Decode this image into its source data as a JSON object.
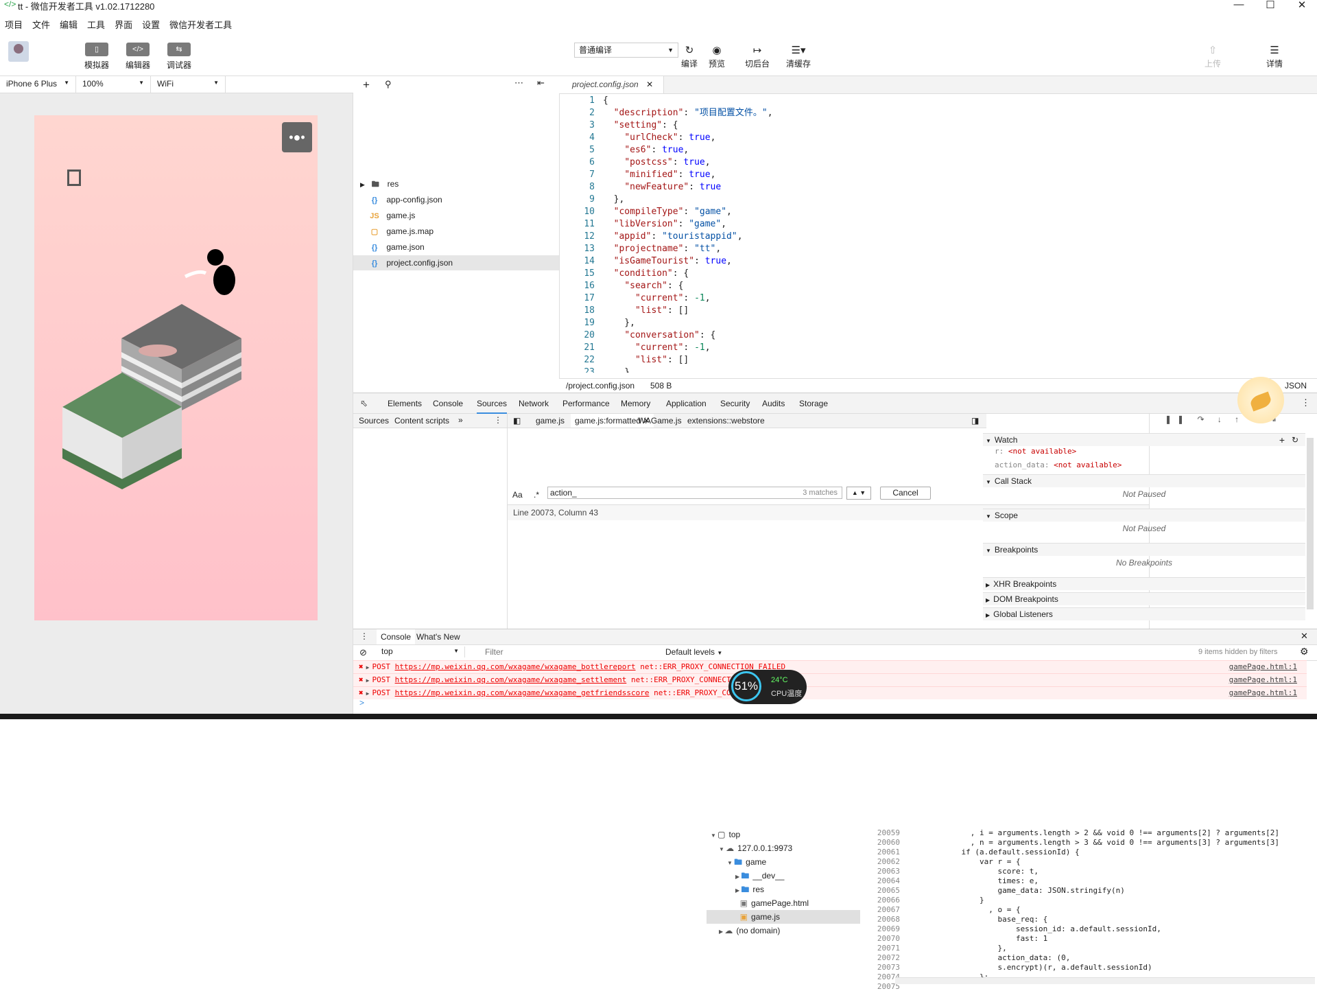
{
  "window": {
    "title": "tt - 微信开发者工具 v1.02.1712280"
  },
  "menu": [
    "项目",
    "文件",
    "编辑",
    "工具",
    "界面",
    "设置",
    "微信开发者工具"
  ],
  "toolbar": {
    "left_buttons": [
      {
        "label": "模拟器",
        "icon": "phone-icon"
      },
      {
        "label": "编辑器",
        "icon": "code-icon"
      },
      {
        "label": "调试器",
        "icon": "debug-icon"
      }
    ],
    "compile_mode": "普通编译",
    "center_buttons": [
      {
        "label": "编译",
        "icon": "refresh-icon"
      },
      {
        "label": "预览",
        "icon": "eye-icon"
      },
      {
        "label": "切后台",
        "icon": "background-icon"
      },
      {
        "label": "清缓存",
        "icon": "layers-icon"
      }
    ],
    "upload": "上传",
    "details": "详情"
  },
  "device": {
    "model": "iPhone 6 Plus",
    "zoom": "100%",
    "network": "WiFi"
  },
  "files": [
    {
      "name": "res",
      "type": "folder"
    },
    {
      "name": "app-config.json",
      "type": "json"
    },
    {
      "name": "game.js",
      "type": "js"
    },
    {
      "name": "game.js.map",
      "type": "map"
    },
    {
      "name": "game.json",
      "type": "json"
    },
    {
      "name": "project.config.json",
      "type": "json",
      "selected": true
    }
  ],
  "editor": {
    "tab": "project.config.json",
    "lines": [
      "{",
      "  \"description\": \"项目配置文件。\",",
      "  \"setting\": {",
      "    \"urlCheck\": true,",
      "    \"es6\": true,",
      "    \"postcss\": true,",
      "    \"minified\": true,",
      "    \"newFeature\": true",
      "  },",
      "  \"compileType\": \"game\",",
      "  \"libVersion\": \"game\",",
      "  \"appid\": \"touristappid\",",
      "  \"projectname\": \"tt\",",
      "  \"isGameTourist\": true,",
      "  \"condition\": {",
      "    \"search\": {",
      "      \"current\": -1,",
      "      \"list\": []",
      "    },",
      "    \"conversation\": {",
      "      \"current\": -1,",
      "      \"list\": []",
      "    },"
    ],
    "status_path": "/project.config.json",
    "status_size": "508 B",
    "status_lang": "JSON"
  },
  "devtools": {
    "tabs": [
      "Elements",
      "Console",
      "Sources",
      "Network",
      "Performance",
      "Memory",
      "Application",
      "Security",
      "Audits",
      "Storage"
    ],
    "active_tab": "Sources",
    "nav_tabs": [
      "Sources",
      "Content scripts"
    ],
    "tree": [
      {
        "label": "top",
        "depth": 0,
        "icon": "frame"
      },
      {
        "label": "127.0.0.1:9973",
        "depth": 1,
        "icon": "cloud"
      },
      {
        "label": "game",
        "depth": 2,
        "icon": "folder"
      },
      {
        "label": "__dev__",
        "depth": 3,
        "icon": "folder"
      },
      {
        "label": "res",
        "depth": 3,
        "icon": "folder"
      },
      {
        "label": "gamePage.html",
        "depth": 3,
        "icon": "file"
      },
      {
        "label": "game.js",
        "depth": 3,
        "icon": "jsfile",
        "selected": true
      },
      {
        "label": "(no domain)",
        "depth": 1,
        "icon": "cloud"
      }
    ],
    "file_tabs": [
      "game.js",
      "game.js:formatted",
      "WAGame.js",
      "extensions::webstore"
    ],
    "code": [
      {
        "ln": "20059",
        "text": "              , i = arguments.length > 2 && void 0 !== arguments[2] ? arguments[2]"
      },
      {
        "ln": "20060",
        "text": "              , n = arguments.length > 3 && void 0 !== arguments[3] ? arguments[3]"
      },
      {
        "ln": "20061",
        "text": "            if (a.default.sessionId) {"
      },
      {
        "ln": "20062",
        "text": "                var r = {"
      },
      {
        "ln": "20063",
        "text": "                    score: t,"
      },
      {
        "ln": "20064",
        "text": "                    times: e,"
      },
      {
        "ln": "20065",
        "text": "                    game_data: JSON.stringify(n)"
      },
      {
        "ln": "20066",
        "text": "                }"
      },
      {
        "ln": "20067",
        "text": "                  , o = {"
      },
      {
        "ln": "20068",
        "text": "                    base_req: {"
      },
      {
        "ln": "20069",
        "text": "                        session_id: a.default.sessionId,"
      },
      {
        "ln": "20070",
        "text": "                        fast: 1"
      },
      {
        "ln": "20071",
        "text": "                    },"
      },
      {
        "ln": "20072",
        "text": "                    action_data: (0,"
      },
      {
        "ln": "20073",
        "text": "                    s.encrypt)(r, a.default.sessionId)"
      },
      {
        "ln": "20074",
        "text": "                };"
      },
      {
        "ln": "20075",
        "text": ""
      }
    ],
    "search": {
      "value": "action_",
      "matches": "3 matches",
      "cancel": "Cancel",
      "case_label": "Aa",
      "regex_label": ".*"
    },
    "cursor_status": "Line 20073, Column 43",
    "watch": {
      "title": "Watch",
      "items": [
        {
          "name": "r",
          "value": "<not available>"
        },
        {
          "name": "action_data",
          "value": "<not available>"
        }
      ]
    },
    "sections": [
      {
        "title": "Call Stack",
        "note": "Not Paused"
      },
      {
        "title": "Scope",
        "note": "Not Paused"
      },
      {
        "title": "Breakpoints",
        "note": "No Breakpoints"
      }
    ],
    "collapsed_sections": [
      "XHR Breakpoints",
      "DOM Breakpoints",
      "Global Listeners"
    ]
  },
  "console": {
    "tabs": [
      "Console",
      "What's New"
    ],
    "context": "top",
    "filter_placeholder": "Filter",
    "levels": "Default levels",
    "hidden": "9 items hidden by filters",
    "errors": [
      {
        "method": "POST",
        "url": "https://mp.weixin.qq.com/wxagame/wxagame_bottlereport",
        "error": "net::ERR_PROXY_CONNECTION_FAILED",
        "source": "gamePage.html:1"
      },
      {
        "method": "POST",
        "url": "https://mp.weixin.qq.com/wxagame/wxagame_settlement",
        "error": "net::ERR_PROXY_CONNECTION_FAILED",
        "source": "gamePage.html:1"
      },
      {
        "method": "POST",
        "url": "https://mp.weixin.qq.com/wxagame/wxagame_getfriendsscore",
        "error": "net::ERR_PROXY_CONNECTION_FAILED",
        "source": "gamePage.html:1"
      }
    ],
    "prompt": ">"
  },
  "overlay": {
    "cpu_percent": "51%",
    "temp": "24°C",
    "temp_label": "CPU温度"
  },
  "colors": {
    "accent": "#3a8dde",
    "error": "#e00000",
    "game_bg_top": "#ffd6d0",
    "game_bg_bottom": "#ffc1ca"
  }
}
